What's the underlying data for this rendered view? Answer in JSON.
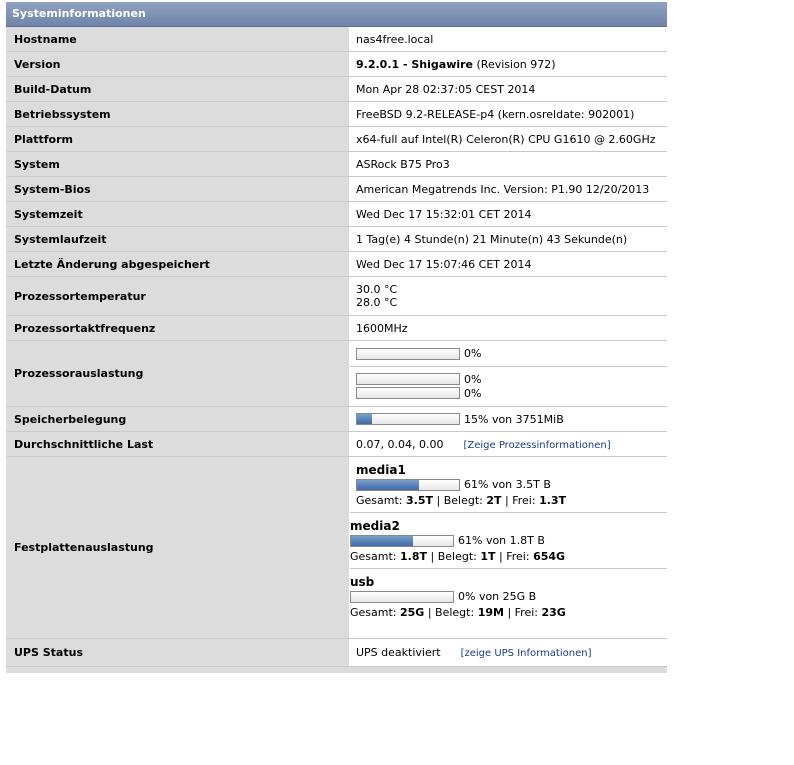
{
  "panel_title": "Systeminformationen",
  "rows": {
    "hostname": {
      "label": "Hostname",
      "value": "nas4free.local"
    },
    "version": {
      "label": "Version",
      "value_bold": "9.2.0.1 - Shigawire",
      "value_rest": " (Revision 972)"
    },
    "build": {
      "label": "Build-Datum",
      "value": "Mon Apr 28 02:37:05 CEST 2014"
    },
    "os": {
      "label": "Betriebssystem",
      "value": "FreeBSD 9.2-RELEASE-p4 (kern.osreldate: 902001)"
    },
    "platform": {
      "label": "Plattform",
      "value": "x64-full auf Intel(R) Celeron(R) CPU G1610 @ 2.60GHz"
    },
    "system": {
      "label": "System",
      "value": "ASRock B75 Pro3"
    },
    "bios": {
      "label": "System-Bios",
      "value": "American Megatrends Inc. Version: P1.90 12/20/2013"
    },
    "systime": {
      "label": "Systemzeit",
      "value": "Wed Dec 17 15:32:01 CET 2014"
    },
    "uptime": {
      "label": "Systemlaufzeit",
      "value": "1 Tag(e) 4 Stunde(n) 21 Minute(n) 43 Sekunde(n)"
    },
    "lastchange": {
      "label": "Letzte Änderung abgespeichert",
      "value": "Wed Dec 17 15:07:46 CET 2014"
    },
    "temp": {
      "label": "Prozessortemperatur",
      "values": [
        "30.0 °C",
        "28.0 °C"
      ]
    },
    "freq": {
      "label": "Prozessortaktfrequenz",
      "value": "1600MHz"
    },
    "cpuload": {
      "label": "Prozessorauslastung",
      "bars": [
        {
          "pct": 0,
          "text": "0%"
        },
        {
          "pct": 0,
          "text": "0%"
        },
        {
          "pct": 0,
          "text": "0%"
        }
      ]
    },
    "memory": {
      "label": "Speicherbelegung",
      "pct": 15,
      "text": "15% von 3751MiB"
    },
    "load": {
      "label": "Durchschnittliche Last",
      "value": "0.07, 0.04, 0.00",
      "link": "[Zeige Prozessinformationen]"
    },
    "disks": {
      "label": "Festplattenauslastung",
      "items": [
        {
          "name": "media1",
          "pct": 61,
          "text": "61% von 3.5T B",
          "total_label": "Gesamt: ",
          "total": "3.5T",
          "used_label": " | Belegt: ",
          "used": "2T",
          "free_label": " | Frei: ",
          "free": "1.3T"
        },
        {
          "name": "media2",
          "pct": 61,
          "text": "61% von 1.8T B",
          "total_label": "Gesamt: ",
          "total": "1.8T",
          "used_label": " | Belegt: ",
          "used": "1T",
          "free_label": " | Frei: ",
          "free": "654G"
        },
        {
          "name": "usb",
          "pct": 0,
          "text": "0% von 25G B",
          "total_label": "Gesamt: ",
          "total": "25G",
          "used_label": " | Belegt: ",
          "used": "19M",
          "free_label": " | Frei: ",
          "free": "23G"
        }
      ]
    },
    "ups": {
      "label": "UPS Status",
      "value": "UPS deaktiviert",
      "link": "[zeige UPS Informationen]"
    }
  }
}
